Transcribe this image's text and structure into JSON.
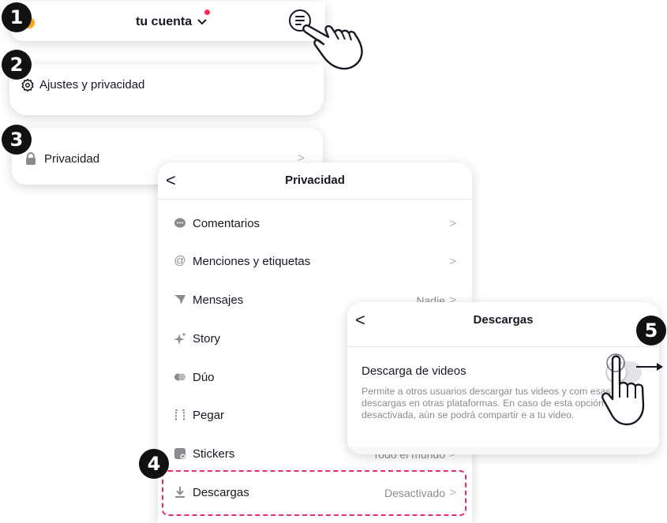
{
  "steps": [
    "1",
    "2",
    "3",
    "4",
    "5"
  ],
  "account_header": {
    "title": "tu cuenta"
  },
  "settings_card": {
    "label": "Ajustes y privacidad"
  },
  "privacy_entry": {
    "label": "Privacidad",
    "chevron": ">"
  },
  "privacy_screen": {
    "back": "<",
    "title": "Privacidad",
    "items": [
      {
        "icon": "comment-icon",
        "label": "Comentarios",
        "value": "",
        "chevron": ">"
      },
      {
        "icon": "at-icon",
        "label": "Menciones y etiquetas",
        "value": "",
        "chevron": ">"
      },
      {
        "icon": "send-icon",
        "label": "Mensajes",
        "value": "Nadie",
        "chevron": ">"
      },
      {
        "icon": "sparkle-icon",
        "label": "Story",
        "value": "",
        "chevron": ""
      },
      {
        "icon": "duet-icon",
        "label": "Dúo",
        "value": "",
        "chevron": ""
      },
      {
        "icon": "stitch-icon",
        "label": "Pegar",
        "value": "",
        "chevron": ""
      },
      {
        "icon": "sticker-icon",
        "label": "Stickers",
        "value": "Todo el mundo",
        "chevron": ">"
      },
      {
        "icon": "download-icon",
        "label": "Descargas",
        "value": "Desactivado",
        "chevron": ">"
      }
    ]
  },
  "downloads_screen": {
    "back": "<",
    "title": "Descargas",
    "setting_title": "Descarga de videos",
    "setting_desc": "Permite a otros usuarios descargar tus videos y com esas descargas en otras plataformas. En caso de esta opción desactivada, aún se podrá compartir e a tu video.",
    "toggle_on": false
  },
  "colors": {
    "accent": "#fe2c55",
    "highlight": "#e32c6e",
    "muted": "#8a8b91"
  }
}
